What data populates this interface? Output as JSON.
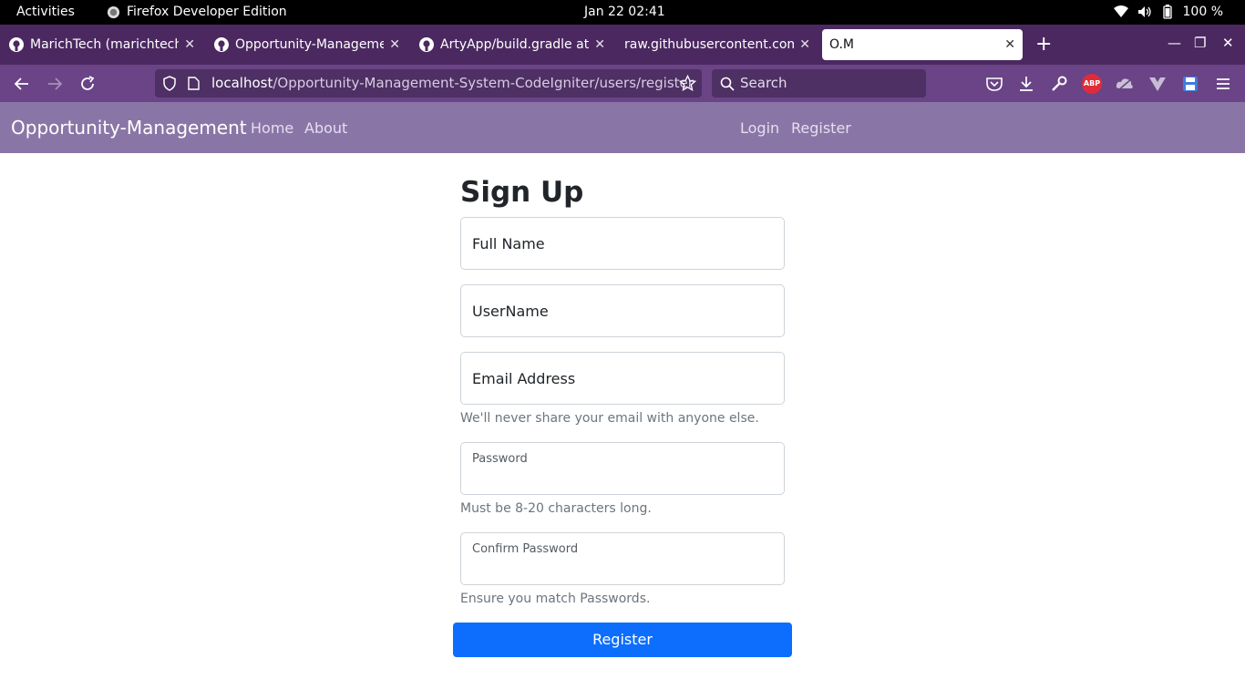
{
  "system": {
    "activities": "Activities",
    "app_name": "Firefox Developer Edition",
    "clock": "Jan 22  02:41",
    "battery": "100 %"
  },
  "tabs": [
    {
      "title": "MarichTech (marichtech)",
      "icon": "github-icon"
    },
    {
      "title": "Opportunity-Management",
      "icon": "github-icon"
    },
    {
      "title": "ArtyApp/build.gradle at m",
      "icon": "github-icon"
    },
    {
      "title": "raw.githubusercontent.com/",
      "icon": ""
    },
    {
      "title": "O.M",
      "icon": "",
      "active": true
    }
  ],
  "toolbar": {
    "url_host": "localhost",
    "url_path": "/Opportunity-Management-System-CodeIgniter/users/register",
    "search_placeholder": "Search",
    "abp_label": "ABP"
  },
  "site": {
    "brand": "Opportunity-Management",
    "nav_left": [
      "Home",
      "About"
    ],
    "nav_right": [
      "Login",
      "Register"
    ]
  },
  "form": {
    "title": "Sign Up",
    "full_name_placeholder": "Full Name",
    "username_placeholder": "UserName",
    "email_placeholder": "Email Address",
    "email_help": "We'll never share your email with anyone else.",
    "password_label": "Password",
    "password_help": "Must be 8-20 characters long.",
    "confirm_label": "Confirm Password",
    "confirm_help": "Ensure you match Passwords.",
    "submit_label": "Register"
  },
  "colors": {
    "tabstrip": "#4b2960",
    "toolbar": "#6a4486",
    "site_nav": "#8a76a6",
    "primary_button": "#0d6efd"
  }
}
